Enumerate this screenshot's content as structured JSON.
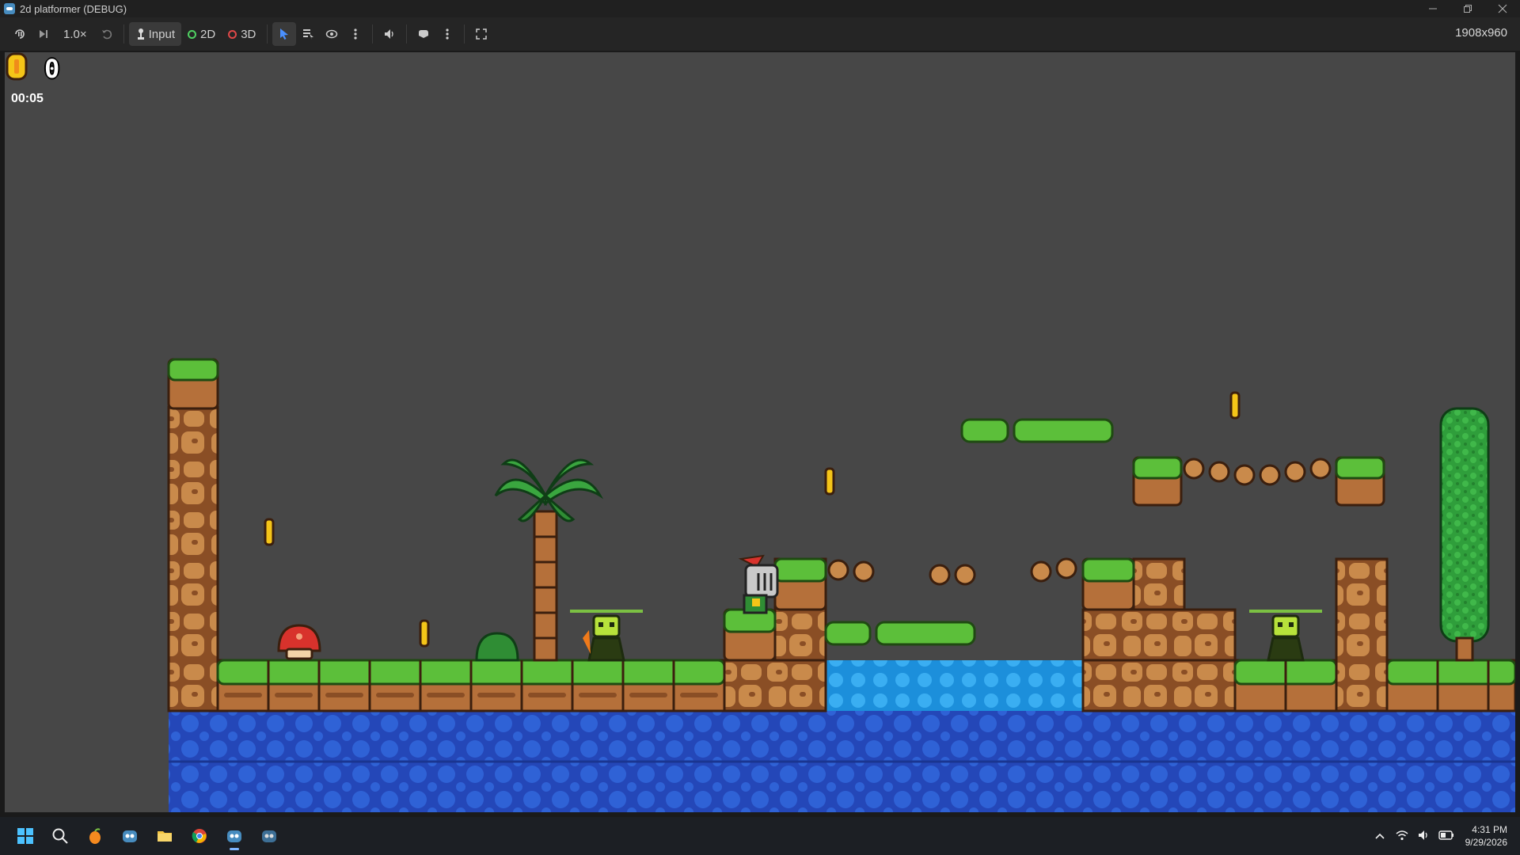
{
  "window": {
    "title": "2d platformer (DEBUG)",
    "minimize_icon": "minimize-icon",
    "maximize_icon": "restore-icon",
    "close_icon": "close-icon"
  },
  "toolbar": {
    "speed": "1.0×",
    "input_label": "Input",
    "mode_2d": "2D",
    "mode_3d": "3D",
    "viewport_size": "1908x960",
    "colors": {
      "mode_2d": "#4fd162",
      "mode_3d": "#e04848",
      "select_active": "#4a90ff"
    }
  },
  "hud": {
    "coin_count": "0",
    "timer": "00:05",
    "coin_icon": "coin-icon"
  },
  "colors": {
    "sky": "#474747",
    "grass": "#5cbf3a",
    "dirt": "#b5703a",
    "water_light": "#1e9be0",
    "water_dark": "#2447b8",
    "coin": "#f5c518"
  },
  "taskbar": {
    "time": "4:31 PM",
    "date": "9/29/2026"
  }
}
